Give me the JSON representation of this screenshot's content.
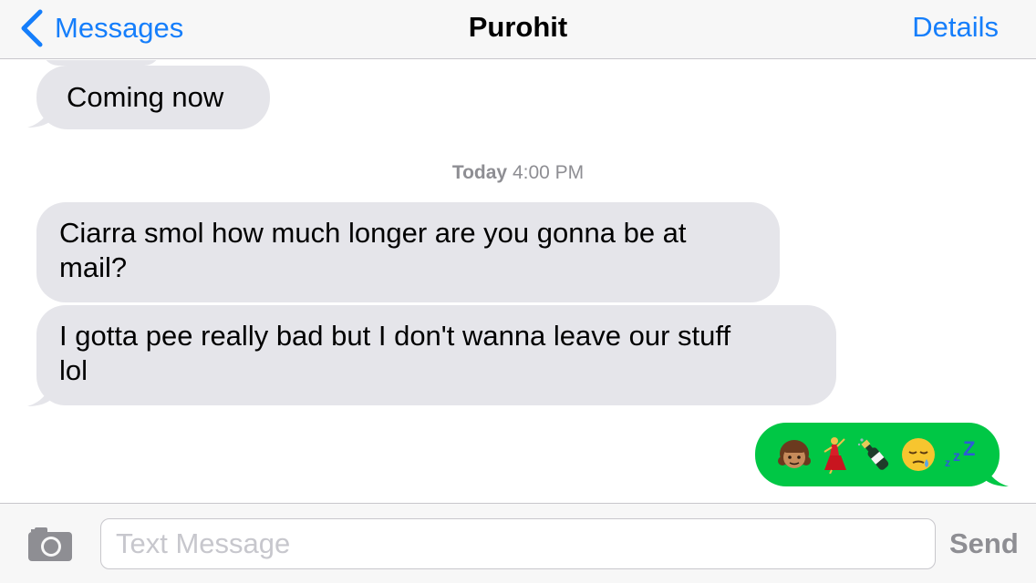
{
  "nav": {
    "back_label": "Messages",
    "title": "Purohit",
    "details_label": "Details"
  },
  "conversation": {
    "received_1": "Coming now",
    "timestamp_day": "Today",
    "timestamp_time": "4:00 PM",
    "received_2_line1": "Ciarra smol how much longer are you gonna be at",
    "received_2_line2": "mail?",
    "received_3_line1": "I gotta pee really bad but I don't wanna leave our stuff",
    "received_3_line2": "lol",
    "sent_emojis": [
      "girl-medium-skin",
      "dancer",
      "champagne-bottle",
      "sleepy-face",
      "zzz"
    ]
  },
  "input": {
    "placeholder": "Text Message",
    "send_label": "Send"
  },
  "colors": {
    "ios_blue": "#157efb",
    "received_bubble": "#e5e5ea",
    "sent_bubble": "#00c745",
    "gray_text": "#8e8e93"
  }
}
